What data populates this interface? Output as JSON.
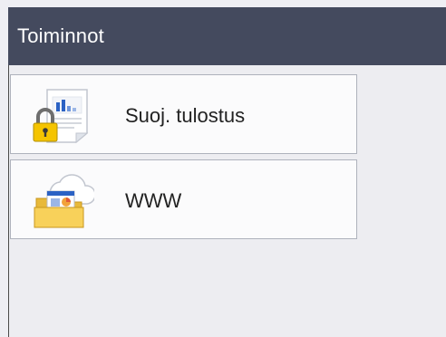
{
  "header": {
    "title": "Toiminnot"
  },
  "menu": {
    "items": [
      {
        "label": "Suoj. tulostus",
        "icon": "secure-print-icon"
      },
      {
        "label": "WWW",
        "icon": "web-folder-icon"
      }
    ]
  },
  "colors": {
    "header_bg": "#444a5e",
    "content_bg": "#ededf1",
    "item_bg": "#fbfbfc",
    "item_border": "#aeb2bc",
    "lock_yellow": "#f5c400",
    "folder_yellow": "#f8d15a",
    "doc_blue": "#2b62c4"
  }
}
